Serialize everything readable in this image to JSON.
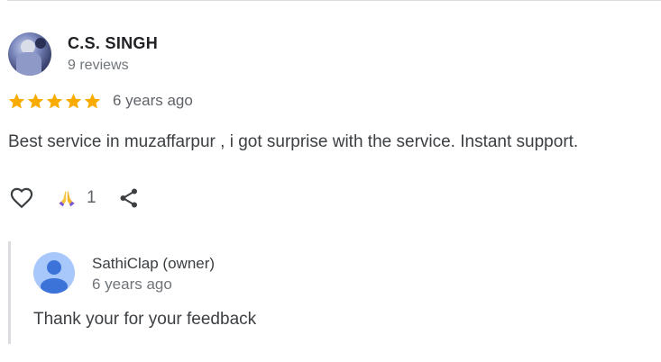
{
  "review": {
    "reviewer_name": "C.S. SINGH",
    "reviewer_review_count": "9 reviews",
    "rating": 5,
    "rating_max": 5,
    "date": "6 years ago",
    "text": "Best service in muzaffarpur , i got surprise with the service. Instant support.",
    "reaction_count": "1"
  },
  "owner_response": {
    "name": "SathiClap (owner)",
    "date": "6 years ago",
    "text": "Thank your for your feedback"
  },
  "icons": {
    "like": "heart-outline-icon",
    "reaction": "folded-hands-icon",
    "share": "share-icon",
    "owner_avatar": "person-icon"
  },
  "colors": {
    "star": "#f9ab00",
    "owner_avatar_bg": "#a8c7fa",
    "owner_avatar_fg": "#3b73d9",
    "reaction_skin": "#f5c542",
    "reaction_sleeve": "#7b57d6"
  }
}
